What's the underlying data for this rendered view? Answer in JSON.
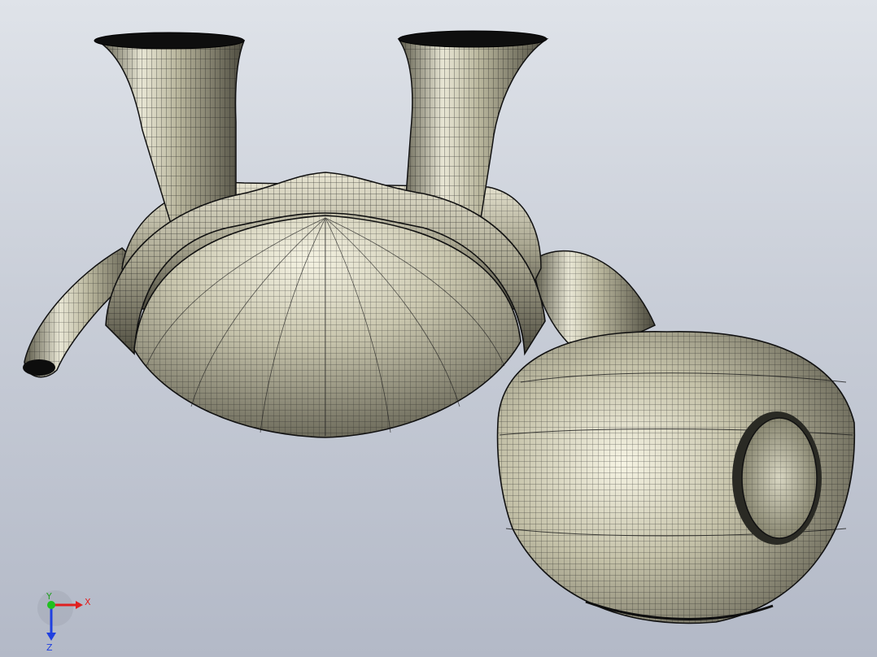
{
  "viewport": {
    "background_top": "#dfe3e9",
    "background_bottom": "#b3b9c7"
  },
  "model": {
    "shaded_color": "#c8c5ad",
    "mesh_color": "#1a1a1a"
  },
  "triad": {
    "x_label": "X",
    "y_label": "Y",
    "z_label": "Z",
    "x_color": "#e02020",
    "y_color": "#20c020",
    "z_color": "#2040e0"
  }
}
